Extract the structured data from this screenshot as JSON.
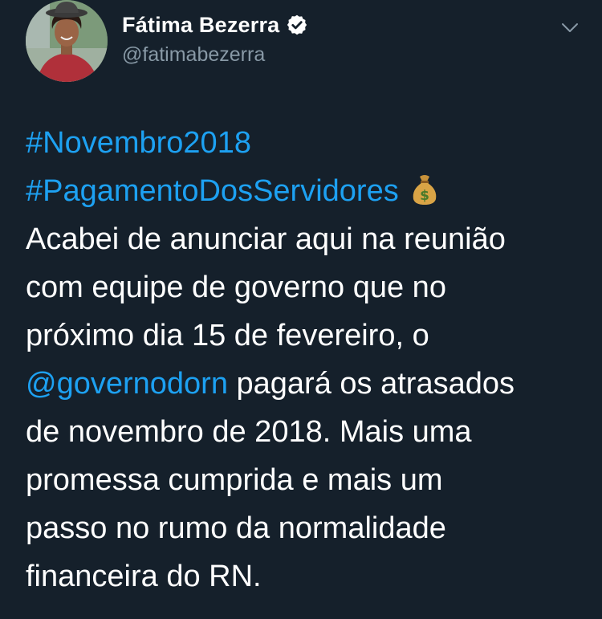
{
  "author": {
    "display_name": "Fátima Bezerra",
    "handle": "@fatimabezerra",
    "verified_icon": "verified-badge-icon",
    "avatar": "profile-photo"
  },
  "menu": {
    "icon": "chevron-down-icon"
  },
  "tweet": {
    "hashtag_1": "#Novembro2018",
    "hashtag_2": "#PagamentoDosServidores",
    "emoji": "money-bag-icon",
    "line_1": "Acabei de anunciar aqui na reunião",
    "line_2": "com equipe de governo que no",
    "line_3": "próximo dia 15 de fevereiro, o",
    "mention": "@governodorn",
    "line_4_rest": " pagará os atrasados",
    "line_5": "de novembro de 2018. Mais uma",
    "line_6": "promessa cumprida e mais um",
    "line_7": "passo no rumo da normalidade",
    "line_8": "financeira do RN."
  },
  "colors": {
    "background": "#15202b",
    "text": "#ffffff",
    "secondary": "#8899a6",
    "link": "#1da1f2"
  }
}
